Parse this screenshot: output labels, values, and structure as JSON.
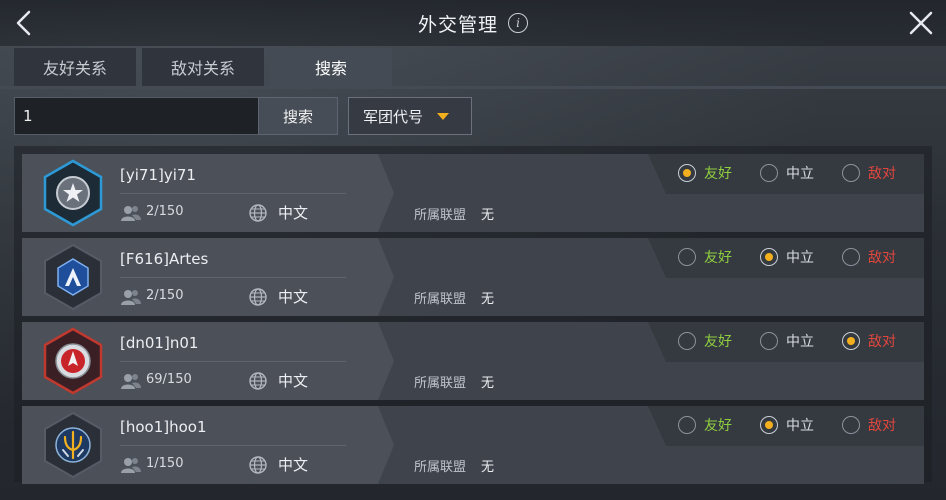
{
  "header": {
    "title": "外交管理"
  },
  "tabs": [
    {
      "label": "友好关系",
      "active": false
    },
    {
      "label": "敌对关系",
      "active": false
    },
    {
      "label": "搜索",
      "active": true
    }
  ],
  "search": {
    "input_value": "1",
    "button_label": "搜索",
    "filter_selected": "军团代号"
  },
  "labels": {
    "alliance": "所属联盟"
  },
  "relations": {
    "friendly": "友好",
    "neutral": "中立",
    "hostile": "敌对"
  },
  "colors": {
    "friendly": "#8fcf3f",
    "neutral": "#d9dde2",
    "hostile": "#e0463d",
    "selected_dot": "#f2b01e"
  },
  "rows": [
    {
      "name": "[yi71]yi71",
      "members": "2/150",
      "lang": "中文",
      "alliance": "无",
      "selected": "friendly",
      "emblem": "star-emblem-icon"
    },
    {
      "name": "[F616]Artes",
      "members": "2/150",
      "lang": "中文",
      "alliance": "无",
      "selected": "neutral",
      "emblem": "a-emblem-icon"
    },
    {
      "name": "[dn01]n01",
      "members": "69/150",
      "lang": "中文",
      "alliance": "无",
      "selected": "hostile",
      "emblem": "ship-emblem-icon"
    },
    {
      "name": "[hoo1]hoo1",
      "members": "1/150",
      "lang": "中文",
      "alliance": "无",
      "selected": "neutral",
      "emblem": "trident-emblem-icon"
    }
  ]
}
